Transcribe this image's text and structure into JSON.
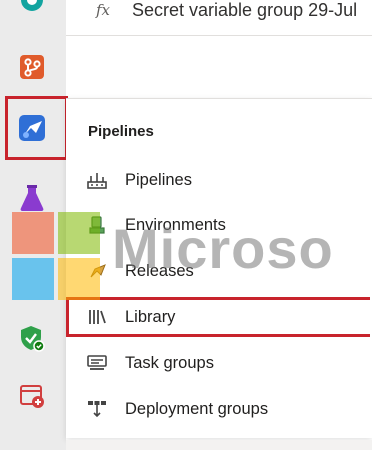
{
  "top_bar": {
    "fx_glyph": "fx",
    "item_text": "Secret variable group 29-Jul"
  },
  "rail": {
    "items": [
      {
        "icon": "overview-icon",
        "color": "#009ccc"
      },
      {
        "icon": "repos-icon",
        "color": "#e05b2b"
      },
      {
        "icon": "pipelines-icon",
        "color": "#2f6fd6",
        "selected": true
      },
      {
        "icon": "test-plans-icon",
        "color": "#8a3bcf"
      },
      {
        "icon": "artifacts-icon",
        "color": "#2fa04a"
      },
      {
        "icon": "security-shield-icon",
        "color": "#2fa04a"
      },
      {
        "icon": "add-extension-icon",
        "color": "#d13f3f"
      }
    ],
    "highlight_color": "#c8232c"
  },
  "flyout": {
    "header": "Pipelines",
    "items": [
      {
        "label": "Pipelines",
        "icon": "pipelines-rocket-icon"
      },
      {
        "label": "Environments",
        "icon": "environments-icon"
      },
      {
        "label": "Releases",
        "icon": "releases-icon"
      },
      {
        "label": "Library",
        "icon": "library-icon",
        "highlighted": true
      },
      {
        "label": "Task groups",
        "icon": "task-groups-icon"
      },
      {
        "label": "Deployment groups",
        "icon": "deployment-groups-icon"
      }
    ]
  },
  "watermark": {
    "text": "Microso",
    "colors": [
      "#f25022",
      "#7fba00",
      "#00a4ef",
      "#ffb900"
    ]
  }
}
